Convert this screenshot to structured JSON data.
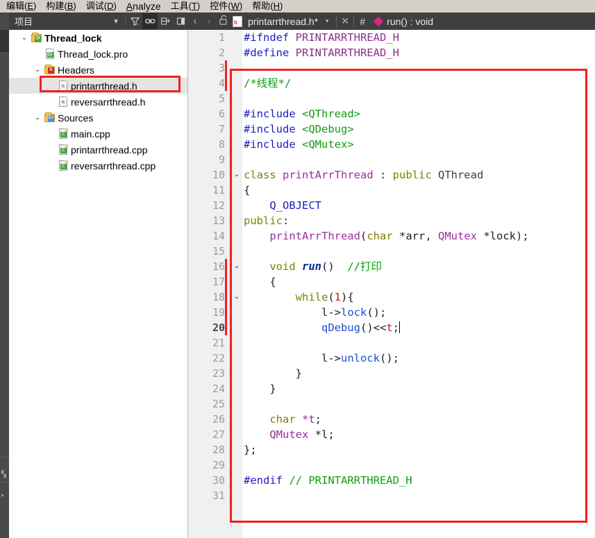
{
  "menubar": {
    "items": [
      {
        "pre": "编辑(",
        "mn": "E",
        "post": ")",
        "latin": false
      },
      {
        "pre": "构建(",
        "mn": "B",
        "post": ")",
        "latin": false
      },
      {
        "pre": "调试(",
        "mn": "D",
        "post": ")",
        "latin": false
      },
      {
        "pre": "",
        "mn": "A",
        "post": "nalyze",
        "latin": true
      },
      {
        "pre": "工具(",
        "mn": "T",
        "post": ")",
        "latin": false
      },
      {
        "pre": "控件(",
        "mn": "W",
        "post": ")",
        "latin": false
      },
      {
        "pre": "帮助(",
        "mn": "H",
        "post": ")",
        "latin": false
      }
    ]
  },
  "project_panel": {
    "title": "项目",
    "toolbar": {
      "dropdown": "▾",
      "filter_icon": "filter",
      "link_icon": "link",
      "split_icon": "split",
      "close_icon": "close"
    },
    "tree": [
      {
        "depth": 0,
        "chev": "⌄",
        "icon": "folder-qt",
        "label": "Thread_lock",
        "bold": true,
        "selected": false
      },
      {
        "depth": 1,
        "chev": "",
        "icon": "doc-qt",
        "label": "Thread_lock.pro",
        "bold": false,
        "selected": false
      },
      {
        "depth": 1,
        "chev": "⌄",
        "icon": "folder-h",
        "label": "Headers",
        "bold": false,
        "selected": false
      },
      {
        "depth": 2,
        "chev": "",
        "icon": "doc-h",
        "label": "printarrthread.h",
        "bold": false,
        "selected": true
      },
      {
        "depth": 2,
        "chev": "",
        "icon": "doc-h",
        "label": "reversarrthread.h",
        "bold": false,
        "selected": false
      },
      {
        "depth": 1,
        "chev": "⌄",
        "icon": "folder-c",
        "label": "Sources",
        "bold": false,
        "selected": false
      },
      {
        "depth": 2,
        "chev": "",
        "icon": "doc-cpp",
        "label": "main.cpp",
        "bold": false,
        "selected": false
      },
      {
        "depth": 2,
        "chev": "",
        "icon": "doc-cpp",
        "label": "printarrthread.cpp",
        "bold": false,
        "selected": false
      },
      {
        "depth": 2,
        "chev": "",
        "icon": "doc-cpp",
        "label": "reversarrthread.cpp",
        "bold": false,
        "selected": false
      }
    ]
  },
  "editor_toolbar": {
    "back_arrow": "‹",
    "forward_arrow": "›",
    "lock_icon": "unlocked",
    "file_icon_letter": "h",
    "filename": "printarrthread.h*",
    "file_dropdown": "▾",
    "close_label": "✕",
    "hash_label": "#",
    "symbol_marker": "method-diamond",
    "symbol": "run() : void"
  },
  "editor": {
    "current_line": 20,
    "total_lines": 31,
    "change_marker_lines": [
      3,
      4,
      16,
      17,
      18,
      19,
      20
    ],
    "fold_marker_lines": [
      10,
      16,
      18
    ],
    "lines": [
      {
        "n": 1,
        "tokens": [
          {
            "t": "#ifndef ",
            "c": "t-pp"
          },
          {
            "t": "PRINTARRTHREAD_H",
            "c": "t-ppid"
          }
        ]
      },
      {
        "n": 2,
        "tokens": [
          {
            "t": "#define ",
            "c": "t-pp"
          },
          {
            "t": "PRINTARRTHREAD_H",
            "c": "t-ppid"
          }
        ]
      },
      {
        "n": 3,
        "tokens": []
      },
      {
        "n": 4,
        "tokens": [
          {
            "t": "/*线程*/",
            "c": "t-cmt"
          }
        ]
      },
      {
        "n": 5,
        "tokens": []
      },
      {
        "n": 6,
        "tokens": [
          {
            "t": "#include ",
            "c": "t-pp"
          },
          {
            "t": "<QThread>",
            "c": "t-str"
          }
        ]
      },
      {
        "n": 7,
        "tokens": [
          {
            "t": "#include ",
            "c": "t-pp"
          },
          {
            "t": "<QDebug>",
            "c": "t-str"
          }
        ]
      },
      {
        "n": 8,
        "tokens": [
          {
            "t": "#include ",
            "c": "t-pp"
          },
          {
            "t": "<QMutex>",
            "c": "t-str"
          }
        ]
      },
      {
        "n": 9,
        "tokens": []
      },
      {
        "n": 10,
        "tokens": [
          {
            "t": "class ",
            "c": "t-kw"
          },
          {
            "t": "printArrThread",
            "c": "t-type"
          },
          {
            "t": " : ",
            "c": "t-punc"
          },
          {
            "t": "public ",
            "c": "t-kw"
          },
          {
            "t": "QThread",
            "c": "t-cls"
          }
        ]
      },
      {
        "n": 11,
        "tokens": [
          {
            "t": "{",
            "c": "t-punc"
          }
        ]
      },
      {
        "n": 12,
        "tokens": [
          {
            "t": "    ",
            "c": "t-punc"
          },
          {
            "t": "Q_OBJECT",
            "c": "t-macro"
          }
        ]
      },
      {
        "n": 13,
        "tokens": [
          {
            "t": "public",
            "c": "t-kw"
          },
          {
            "t": ":",
            "c": "t-punc"
          }
        ]
      },
      {
        "n": 14,
        "tokens": [
          {
            "t": "    ",
            "c": "t-punc"
          },
          {
            "t": "printArrThread",
            "c": "t-type"
          },
          {
            "t": "(",
            "c": "t-punc"
          },
          {
            "t": "char ",
            "c": "t-kw"
          },
          {
            "t": "*arr",
            "c": "t-punc"
          },
          {
            "t": ", ",
            "c": "t-punc"
          },
          {
            "t": "QMutex ",
            "c": "t-type"
          },
          {
            "t": "*lock);",
            "c": "t-punc"
          }
        ]
      },
      {
        "n": 15,
        "tokens": []
      },
      {
        "n": 16,
        "tokens": [
          {
            "t": "    ",
            "c": "t-punc"
          },
          {
            "t": "void ",
            "c": "t-kw"
          },
          {
            "t": "run",
            "c": "t-virt"
          },
          {
            "t": "()  ",
            "c": "t-punc"
          },
          {
            "t": "//打印",
            "c": "t-cmt"
          }
        ]
      },
      {
        "n": 17,
        "tokens": [
          {
            "t": "    {",
            "c": "t-punc"
          }
        ]
      },
      {
        "n": 18,
        "tokens": [
          {
            "t": "        ",
            "c": "t-punc"
          },
          {
            "t": "while",
            "c": "t-kw"
          },
          {
            "t": "(",
            "c": "t-punc"
          },
          {
            "t": "1",
            "c": "t-num"
          },
          {
            "t": "){",
            "c": "t-punc"
          }
        ]
      },
      {
        "n": 19,
        "tokens": [
          {
            "t": "            l->",
            "c": "t-punc"
          },
          {
            "t": "lock",
            "c": "t-fn"
          },
          {
            "t": "();",
            "c": "t-punc"
          }
        ]
      },
      {
        "n": 20,
        "tokens": [
          {
            "t": "            ",
            "c": "t-punc"
          },
          {
            "t": "qDebug",
            "c": "t-fn"
          },
          {
            "t": "()<<",
            "c": "t-punc"
          },
          {
            "t": "t",
            "c": "t-num"
          },
          {
            "t": ";",
            "c": "t-punc"
          }
        ],
        "caret": true
      },
      {
        "n": 21,
        "tokens": []
      },
      {
        "n": 22,
        "tokens": [
          {
            "t": "            l->",
            "c": "t-punc"
          },
          {
            "t": "unlock",
            "c": "t-fn"
          },
          {
            "t": "();",
            "c": "t-punc"
          }
        ]
      },
      {
        "n": 23,
        "tokens": [
          {
            "t": "        }",
            "c": "t-punc"
          }
        ]
      },
      {
        "n": 24,
        "tokens": [
          {
            "t": "    }",
            "c": "t-punc"
          }
        ]
      },
      {
        "n": 25,
        "tokens": []
      },
      {
        "n": 26,
        "tokens": [
          {
            "t": "    ",
            "c": "t-punc"
          },
          {
            "t": "char ",
            "c": "t-kw"
          },
          {
            "t": "*t",
            "c": "t-field"
          },
          {
            "t": ";",
            "c": "t-punc"
          }
        ]
      },
      {
        "n": 27,
        "tokens": [
          {
            "t": "    ",
            "c": "t-punc"
          },
          {
            "t": "QMutex ",
            "c": "t-type"
          },
          {
            "t": "*l",
            "c": "t-punc"
          },
          {
            "t": ";",
            "c": "t-punc"
          }
        ]
      },
      {
        "n": 28,
        "tokens": [
          {
            "t": "};",
            "c": "t-punc"
          }
        ]
      },
      {
        "n": 29,
        "tokens": []
      },
      {
        "n": 30,
        "tokens": [
          {
            "t": "#endif ",
            "c": "t-pp"
          },
          {
            "t": "// PRINTARRTHREAD_H",
            "c": "t-cmt"
          }
        ]
      },
      {
        "n": 31,
        "tokens": []
      }
    ]
  },
  "annotations": {
    "accent_color": "#f02020",
    "tree_box_target": "printarrthread.h",
    "code_box_target": "class printArrThread body"
  }
}
